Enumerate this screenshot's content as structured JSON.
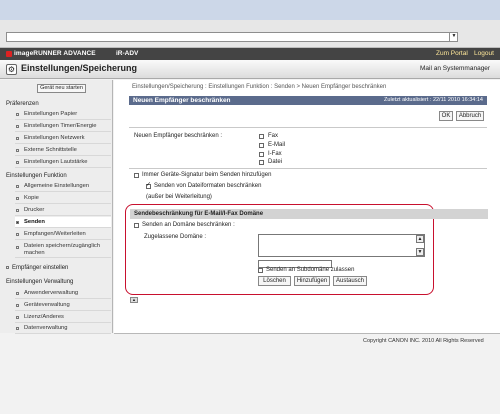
{
  "header": {
    "brand": "imageRUNNER ADVANCE",
    "device": "iR-ADV",
    "portal": "Zum Portal",
    "logout": "Logout"
  },
  "title_bar": {
    "title": "Einstellungen/Speicherung",
    "mail_admin": "Mail an Systemmanager"
  },
  "sidebar": {
    "restart": "Gerät neu starten",
    "sections": [
      {
        "label": "Präferenzen",
        "items": [
          "Einstellungen Papier",
          "Einstellungen Timer/Energie",
          "Einstellungen Netzwerk",
          "Externe Schnittstelle",
          "Einstellungen Lautstärke"
        ]
      },
      {
        "label": "Einstellungen Funktion",
        "items": [
          "Allgemeine Einstellungen",
          "Kopie",
          "Drucker",
          "Senden",
          "Empfangen/Weiterleiten",
          "Dateien speichern/zugänglich machen"
        ]
      },
      {
        "label": "Empfänger einstellen"
      },
      {
        "label": "Einstellungen Verwaltung",
        "items": [
          "Anwenderverwaltung",
          "Geräteverwaltung",
          "Lizenz/Anderes",
          "Datenverwaltung"
        ]
      }
    ]
  },
  "main": {
    "breadcrumb": "Einstellungen/Speicherung : Einstellungen Funktion : Senden > Neuen Empfänger beschränken",
    "panel_title": "Neuen Empfänger beschränken",
    "last_updated": "Zuletzt aktualisiert : 22/11 2010 16:34:14",
    "ok": "OK",
    "cancel": "Abbruch",
    "restrict_label": "Neuen Empfänger beschränken :",
    "restrict_options": [
      "Fax",
      "E-Mail",
      "I-Fax",
      "Datei"
    ],
    "signature_label": "Immer Geräte-Signatur beim Senden hinzufügen",
    "formats_label": "Senden von Dateiformaten beschränken",
    "formats_note": "(außer bei Weiterleitung)",
    "group_title": "Sendebeschränkung für E-Mail/I-Fax Domäne",
    "domain_restrict_label": "Senden an Domäne beschränken :",
    "allowed_domains_label": "Zugelassene Domäne :",
    "subdomain_label": "Senden an Subdomäne zulassen",
    "delete": "Löschen",
    "add": "Hinzufügen",
    "replace": "Austausch"
  },
  "footer": {
    "copyright": "Copyright CANON INC. 2010 All Rights Reserved"
  }
}
